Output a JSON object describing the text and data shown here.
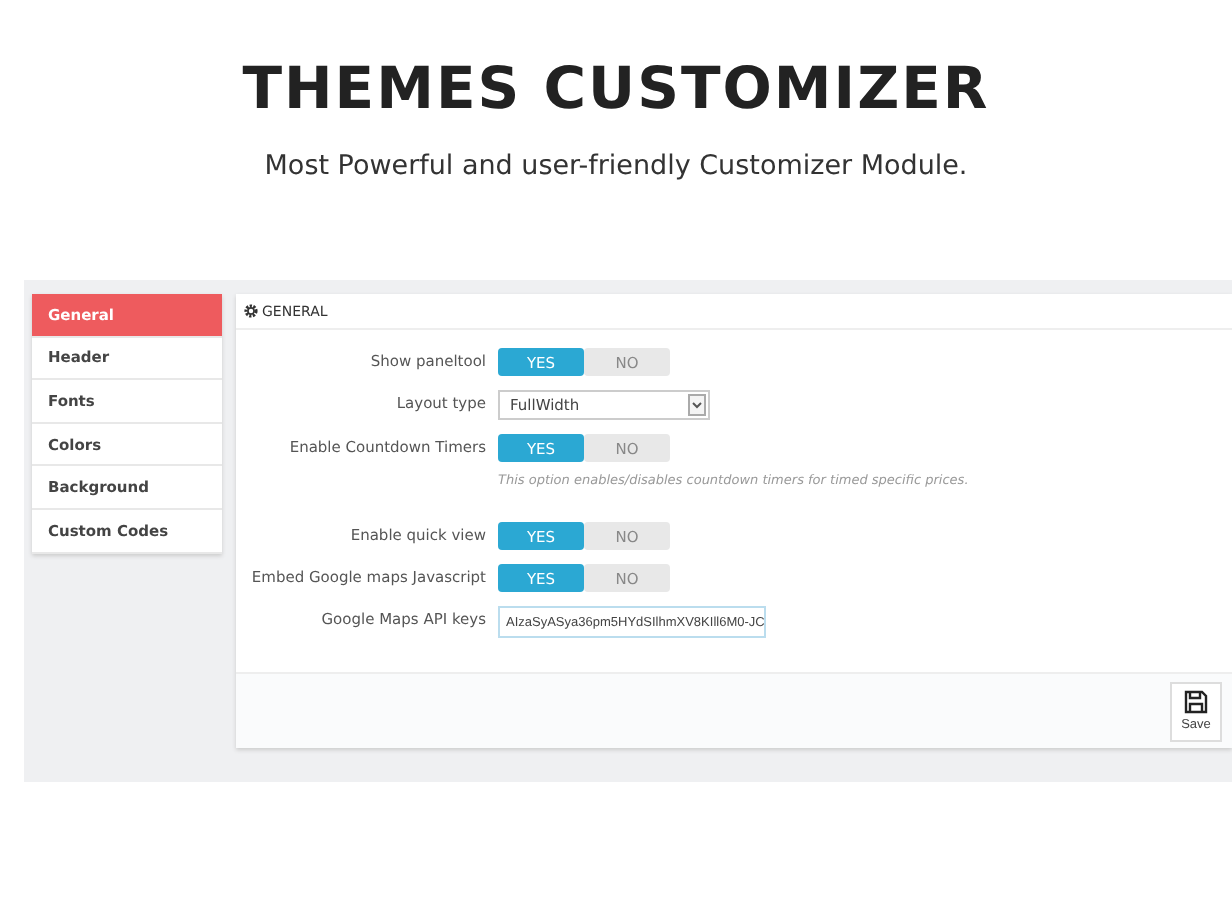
{
  "heading": "THEMES CUSTOMIZER",
  "subtitle": "Most Powerful and user-friendly Customizer Module.",
  "sidebar": {
    "items": [
      {
        "label": "General",
        "selected": true
      },
      {
        "label": "Header",
        "selected": false
      },
      {
        "label": "Fonts",
        "selected": false
      },
      {
        "label": "Colors",
        "selected": false
      },
      {
        "label": "Background",
        "selected": false
      },
      {
        "label": "Custom Codes",
        "selected": false
      }
    ]
  },
  "panel": {
    "title": "GENERAL",
    "rows": [
      {
        "kind": "toggle",
        "label": "Show paneltool",
        "yes": "YES",
        "no": "NO",
        "on": true
      },
      {
        "kind": "select",
        "label": "Layout type",
        "value": "FullWidth"
      },
      {
        "kind": "toggle",
        "label": "Enable Countdown Timers",
        "yes": "YES",
        "no": "NO",
        "on": true,
        "help": "This option enables/disables countdown timers for timed specific prices."
      },
      {
        "kind": "toggle",
        "label": "Enable quick view",
        "yes": "YES",
        "no": "NO",
        "on": true
      },
      {
        "kind": "toggle",
        "label": "Embed Google maps Javascript",
        "yes": "YES",
        "no": "NO",
        "on": true
      },
      {
        "kind": "input",
        "label": "Google Maps API keys",
        "value": "AIzaSyASya36pm5HYdSIlhmXV8KIll6M0-JC"
      }
    ],
    "save": "Save"
  }
}
